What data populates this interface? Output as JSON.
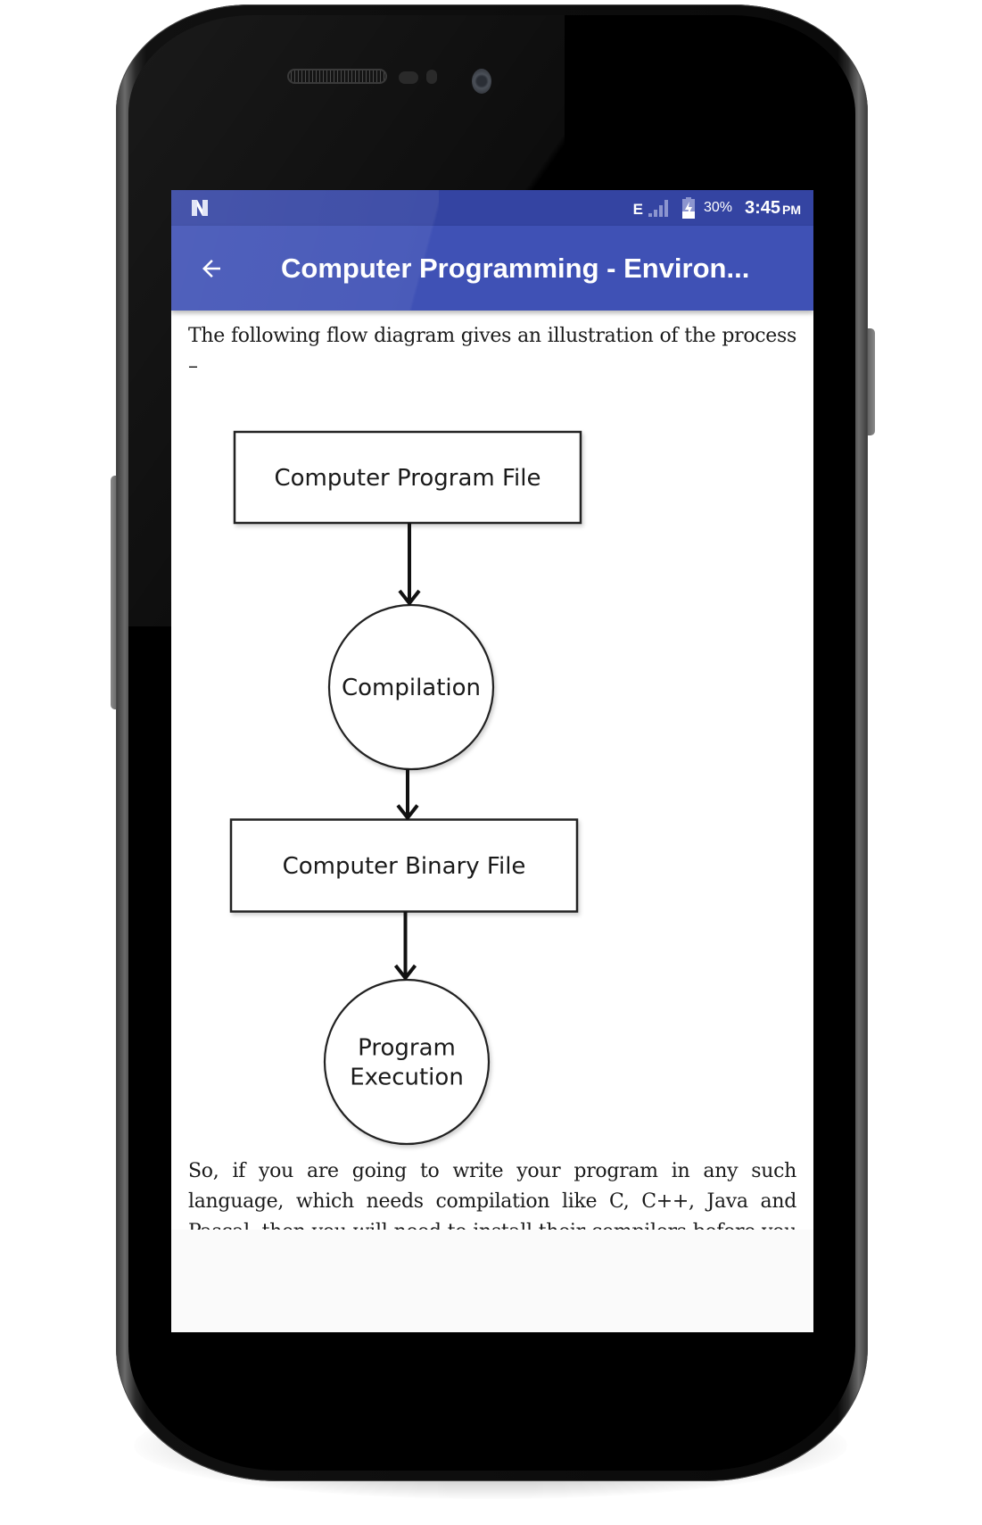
{
  "status_bar": {
    "notification_icon": "n-logo-icon",
    "network_type": "E",
    "signal_icon": "signal-icon",
    "battery_icon": "battery-charging-icon",
    "battery_percent": "30%",
    "time": "3:45",
    "ampm": "PM"
  },
  "toolbar": {
    "back_icon": "arrow-back-icon",
    "title": "Computer Programming - Environ..."
  },
  "content": {
    "intro": "The following flow diagram gives an illustration of the process –",
    "diagram": {
      "nodes": [
        {
          "type": "box",
          "lines": [
            "Computer Program File"
          ]
        },
        {
          "type": "circle",
          "lines": [
            "Compilation"
          ]
        },
        {
          "type": "box",
          "lines": [
            "Computer Binary File"
          ]
        },
        {
          "type": "circle",
          "lines": [
            "Program",
            "Execution"
          ]
        }
      ]
    },
    "outro": "So, if you are going to write your program in any such language, which needs compilation like C, C++, Java and Pascal, then you will need to install their compilers before you start programming."
  },
  "colors": {
    "status_bar": "#3444a2",
    "toolbar": "#3f51b5",
    "content_bg": "#ffffff",
    "screen_bg": "#fafafa"
  }
}
